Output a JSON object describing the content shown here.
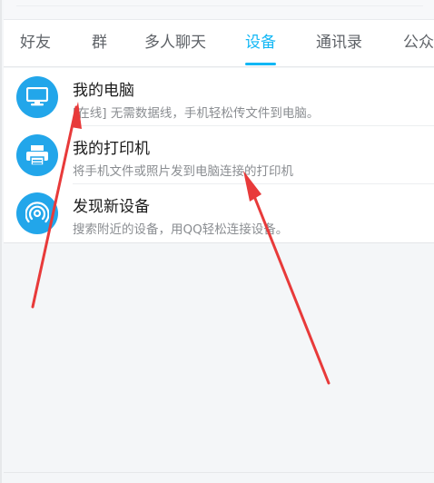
{
  "tabs": [
    {
      "label": "好友"
    },
    {
      "label": "群"
    },
    {
      "label": "多人聊天"
    },
    {
      "label": "设备",
      "active": true
    },
    {
      "label": "通讯录"
    },
    {
      "label": "公众"
    }
  ],
  "devices": [
    {
      "title": "我的电脑",
      "subtitle": "[在线] 无需数据线，手机轻松传文件到电脑。",
      "icon": "monitor-icon"
    },
    {
      "title": "我的打印机",
      "subtitle": "将手机文件或照片发到电脑连接的打印机",
      "icon": "printer-icon"
    },
    {
      "title": "发现新设备",
      "subtitle": "搜索附近的设备，用QQ轻松连接设备。",
      "icon": "signal-icon"
    }
  ],
  "colors": {
    "accent": "#12b7f5",
    "icon_bg": "#22a6ea",
    "annotation_arrow": "#e83a3a"
  }
}
